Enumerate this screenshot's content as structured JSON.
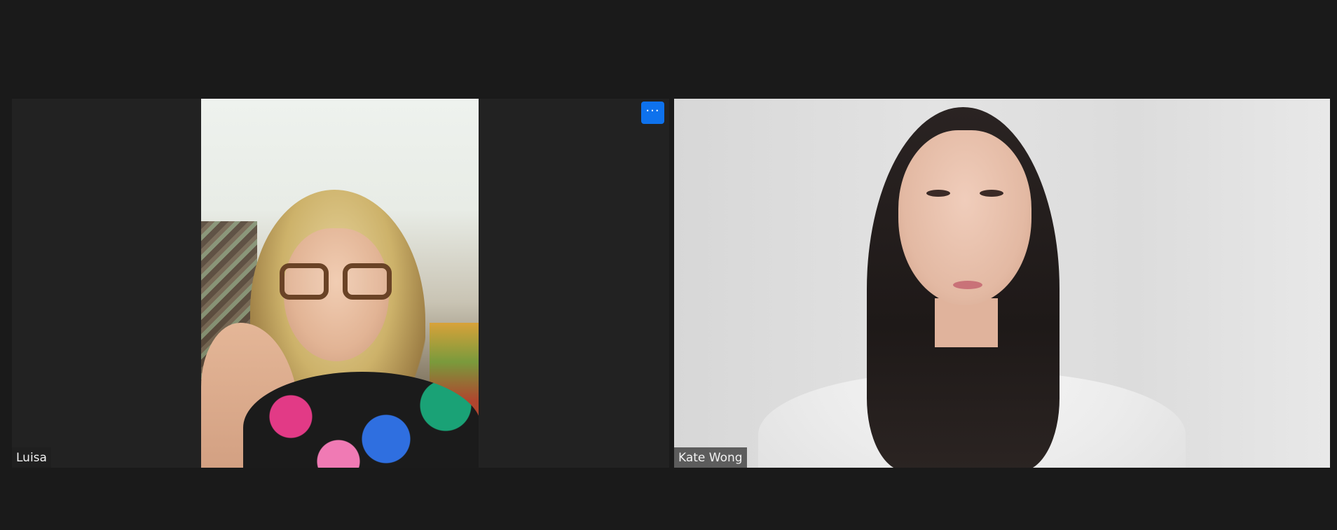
{
  "participants": [
    {
      "name": "Luisa",
      "video": "portrait-camera-feed"
    },
    {
      "name": "Kate Wong",
      "video": "landscape-camera-feed"
    }
  ],
  "controls": {
    "more_options_label": "···",
    "more_options_icon": "more-horizontal-icon",
    "accent_color": "#0e72ed"
  },
  "colors": {
    "background": "#1a1a1a",
    "tile_background": "#222222"
  }
}
